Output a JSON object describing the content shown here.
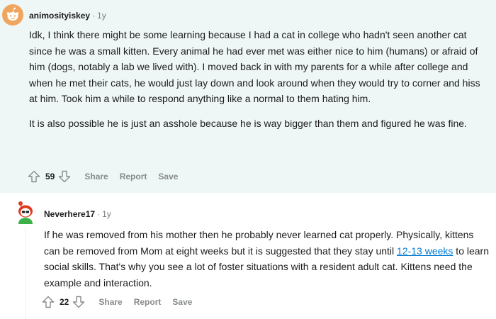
{
  "comments": [
    {
      "author": "animosityiskey",
      "separator": "·",
      "age": "1y",
      "paragraphs": [
        "Idk, I think there might be some learning because I had a cat in college who hadn't seen another cat since he was a small kitten. Every animal he had ever met was either nice to him (humans) or afraid of him (dogs, notably a lab we lived with). I moved back in with my parents for a while after college and when he met their cats, he would just lay down and look around when they would try to corner and hiss at him. Took him a while to respond anything like a normal to them hating him.",
        "It is also possible he is just an asshole because he is way bigger than them and figured he was fine."
      ],
      "score": "59",
      "actions": {
        "share": "Share",
        "report": "Report",
        "save": "Save"
      },
      "icons": {
        "avatar": "orange-snoo-avatar-icon",
        "upvote": "upvote-arrow-icon",
        "downvote": "downvote-arrow-icon"
      },
      "colors": {
        "background": "#eef6f6",
        "avatar": "#f0a55e"
      }
    },
    {
      "author": "Neverhere17",
      "separator": "·",
      "age": "1y",
      "text_before_link": "If he was removed from his mother then he probably never learned cat properly. Physically, kittens can be removed from Mom at eight weeks but it is suggested that they stay until ",
      "link_text": "12-13 weeks",
      "text_after_link": " to learn social skills. That's why you see a lot of foster situations with a resident adult cat. Kittens need the example and interaction.",
      "score": "22",
      "actions": {
        "share": "Share",
        "report": "Report",
        "save": "Save"
      },
      "icons": {
        "avatar": "red-hair-snoo-avatar-icon",
        "upvote": "upvote-arrow-icon",
        "downvote": "downvote-arrow-icon"
      },
      "colors": {
        "link": "#0079d3",
        "hair": "#e03a1e"
      }
    }
  ]
}
